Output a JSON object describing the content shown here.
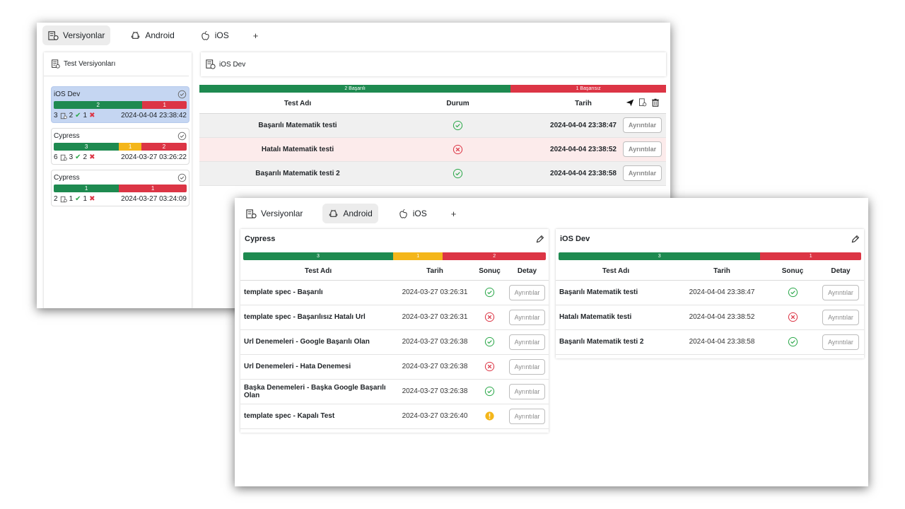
{
  "window1": {
    "tabs": [
      {
        "label": "Versiyonlar",
        "icon": "versions-icon",
        "active": true
      },
      {
        "label": "Android",
        "icon": "android-icon",
        "active": false
      },
      {
        "label": "iOS",
        "icon": "apple-icon",
        "active": false
      }
    ],
    "add_tab": "+",
    "sidebar": {
      "title": "Test Versiyonları",
      "cards": [
        {
          "name": "iOS Dev",
          "selected": true,
          "bar": [
            {
              "v": "2",
              "c": "green"
            },
            {
              "v": "1",
              "c": "red"
            }
          ],
          "total": "3",
          "passed": "2",
          "failed": "1",
          "date": "2024-04-04 23:38:42"
        },
        {
          "name": "Cypress",
          "selected": false,
          "bar": [
            {
              "v": "3",
              "c": "green"
            },
            {
              "v": "1",
              "c": "yellow"
            },
            {
              "v": "2",
              "c": "red"
            }
          ],
          "total": "6",
          "passed": "3",
          "failed": "2",
          "date": "2024-03-27 03:26:22"
        },
        {
          "name": "Cypress",
          "selected": false,
          "bar": [
            {
              "v": "1",
              "c": "green"
            },
            {
              "v": "1",
              "c": "red"
            }
          ],
          "total": "2",
          "passed": "1",
          "failed": "1",
          "date": "2024-03-27 03:24:09"
        }
      ]
    },
    "main": {
      "title": "iOS Dev",
      "bar_success": "2 Başarılı",
      "bar_fail": "1 Başarısız",
      "columns": {
        "name": "Test Adı",
        "status": "Durum",
        "date": "Tarih"
      },
      "rows": [
        {
          "name": "Başarılı Matematik testi",
          "status": "success",
          "date": "2024-04-04 23:38:47",
          "button": "Ayrıntılar"
        },
        {
          "name": "Hatalı Matematik testi",
          "status": "fail",
          "date": "2024-04-04 23:38:52",
          "button": "Ayrıntılar"
        },
        {
          "name": "Başarılı Matematik testi 2",
          "status": "success",
          "date": "2024-04-04 23:38:58",
          "button": "Ayrıntılar"
        }
      ]
    }
  },
  "window2": {
    "tabs": [
      {
        "label": "Versiyonlar",
        "icon": "versions-icon",
        "active": false
      },
      {
        "label": "Android",
        "icon": "android-icon",
        "active": true
      },
      {
        "label": "iOS",
        "icon": "apple-icon",
        "active": false
      }
    ],
    "add_tab": "+",
    "columns": {
      "name": "Test Adı",
      "date": "Tarih",
      "result": "Sonuç",
      "detail": "Detay"
    },
    "panels": [
      {
        "title": "Cypress",
        "bar": [
          {
            "v": "3",
            "c": "green"
          },
          {
            "v": "1",
            "c": "yellow"
          },
          {
            "v": "2",
            "c": "red"
          }
        ],
        "rows": [
          {
            "name": "template spec - Başarılı",
            "date": "2024-03-27 03:26:31",
            "status": "success",
            "button": "Ayrıntılar"
          },
          {
            "name": "template spec - Başarılısız Hatalı Url",
            "date": "2024-03-27 03:26:31",
            "status": "fail",
            "button": "Ayrıntılar"
          },
          {
            "name": "Url Denemeleri - Google Başarılı Olan",
            "date": "2024-03-27 03:26:38",
            "status": "success",
            "button": "Ayrıntılar"
          },
          {
            "name": "Url Denemeleri - Hata Denemesi",
            "date": "2024-03-27 03:26:38",
            "status": "fail",
            "button": "Ayrıntılar"
          },
          {
            "name": "Başka Denemeleri - Başka Google Başarılı Olan",
            "date": "2024-03-27 03:26:38",
            "status": "success",
            "button": "Ayrıntılar"
          },
          {
            "name": "template spec - Kapalı Test",
            "date": "2024-03-27 03:26:40",
            "status": "warning",
            "button": "Ayrıntılar"
          }
        ]
      },
      {
        "title": "iOS Dev",
        "bar": [
          {
            "v": "3",
            "c": "green"
          },
          {
            "v": "1",
            "c": "red"
          }
        ],
        "rows": [
          {
            "name": "Başarılı Matematik testi",
            "date": "2024-04-04 23:38:47",
            "status": "success",
            "button": "Ayrıntılar"
          },
          {
            "name": "Hatalı Matematik testi",
            "date": "2024-04-04 23:38:52",
            "status": "fail",
            "button": "Ayrıntılar"
          },
          {
            "name": "Başarılı Matematik testi 2",
            "date": "2024-04-04 23:38:58",
            "status": "success",
            "button": "Ayrıntılar"
          }
        ]
      }
    ]
  },
  "colors": {
    "green": "#1e8a50",
    "yellow": "#f4b61a",
    "red": "#dc3545",
    "selected": "#c5d6f2"
  }
}
